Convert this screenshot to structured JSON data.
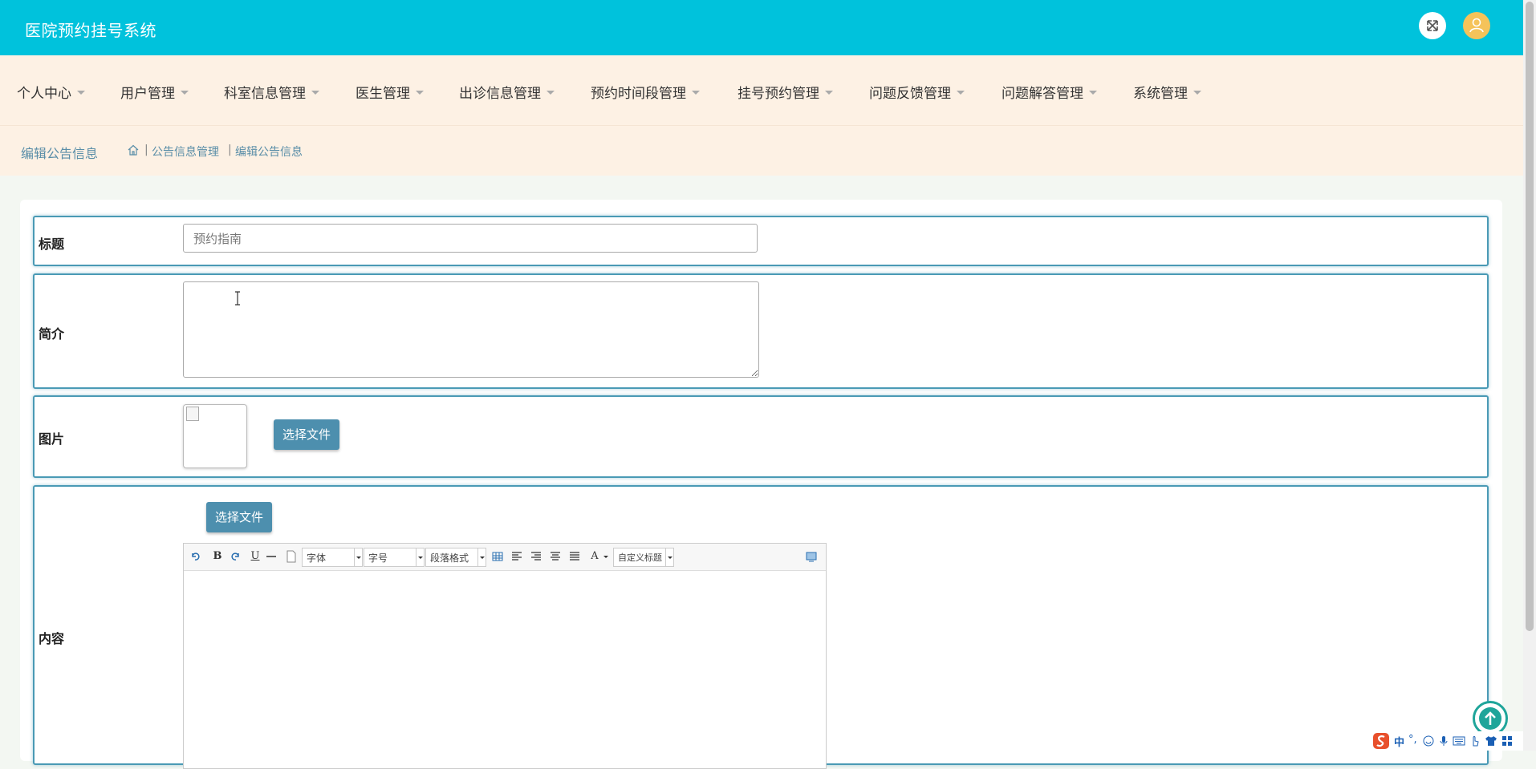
{
  "app": {
    "title": "医院预约挂号系统"
  },
  "header": {
    "fullscreen_icon": "expand-icon",
    "user_icon": "user-icon"
  },
  "nav": {
    "items": [
      {
        "label": "个人中心"
      },
      {
        "label": "用户管理"
      },
      {
        "label": "科室信息管理"
      },
      {
        "label": "医生管理"
      },
      {
        "label": "出诊信息管理"
      },
      {
        "label": "预约时间段管理"
      },
      {
        "label": "挂号预约管理"
      },
      {
        "label": "问题反馈管理"
      },
      {
        "label": "问题解答管理"
      },
      {
        "label": "系统管理"
      }
    ]
  },
  "breadcrumb": {
    "page_title": "编辑公告信息",
    "home_icon": "home-icon",
    "sep": "|",
    "items": [
      "公告信息管理",
      "编辑公告信息"
    ]
  },
  "form": {
    "title_label": "标题",
    "title_value": "预约指南",
    "intro_label": "简介",
    "intro_value": "",
    "image_label": "图片",
    "image_button": "选择文件",
    "content_label": "内容",
    "content_button": "选择文件"
  },
  "editor": {
    "toolbar": {
      "font_family": "字体",
      "font_size": "字号",
      "paragraph": "段落格式",
      "custom_heading": "自定义标题",
      "bold": "B",
      "underline": "U",
      "font_color": "A"
    }
  },
  "ime": {
    "zh": "中",
    "punct": "°,"
  }
}
